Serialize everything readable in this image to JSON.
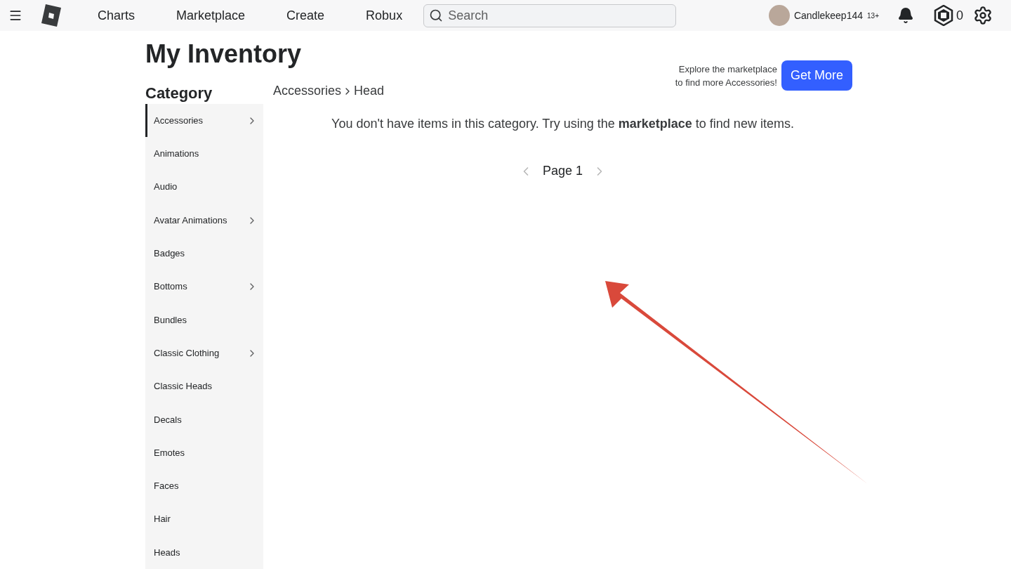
{
  "nav": {
    "links": [
      "Charts",
      "Marketplace",
      "Create",
      "Robux"
    ],
    "search": {
      "placeholder": "Search"
    },
    "user": {
      "name": "Candlekeep144",
      "age_badge": "13+"
    },
    "robux": "0"
  },
  "page": {
    "title": "My Inventory",
    "category_heading": "Category"
  },
  "categories": [
    {
      "label": "Accessories",
      "selected": true,
      "expandable": true
    },
    {
      "label": "Animations",
      "selected": false,
      "expandable": false
    },
    {
      "label": "Audio",
      "selected": false,
      "expandable": false
    },
    {
      "label": "Avatar Animations",
      "selected": false,
      "expandable": true
    },
    {
      "label": "Badges",
      "selected": false,
      "expandable": false
    },
    {
      "label": "Bottoms",
      "selected": false,
      "expandable": true
    },
    {
      "label": "Bundles",
      "selected": false,
      "expandable": false
    },
    {
      "label": "Classic Clothing",
      "selected": false,
      "expandable": true
    },
    {
      "label": "Classic Heads",
      "selected": false,
      "expandable": false
    },
    {
      "label": "Decals",
      "selected": false,
      "expandable": false
    },
    {
      "label": "Emotes",
      "selected": false,
      "expandable": false
    },
    {
      "label": "Faces",
      "selected": false,
      "expandable": false
    },
    {
      "label": "Hair",
      "selected": false,
      "expandable": false
    },
    {
      "label": "Heads",
      "selected": false,
      "expandable": false
    }
  ],
  "breadcrumb": [
    "Accessories",
    "Head"
  ],
  "promo": {
    "text_lines": [
      "Explore the marketplace",
      "to find more Accessories!"
    ],
    "button": "Get More"
  },
  "empty_message": "You don't have items in this category. Try using the **marketplace** to find new items.",
  "pagination": {
    "label": "Page 1",
    "prev_enabled": false,
    "next_enabled": false
  }
}
